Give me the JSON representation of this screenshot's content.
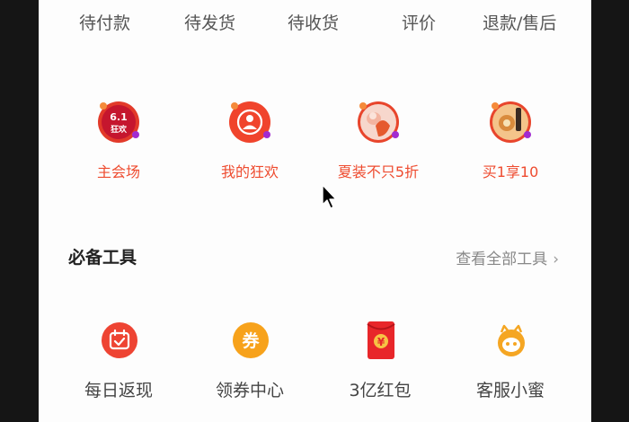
{
  "orders": {
    "tabs": [
      {
        "label": "待付款"
      },
      {
        "label": "待发货"
      },
      {
        "label": "待收货"
      },
      {
        "label": "评价"
      },
      {
        "label": "退款/售后"
      }
    ]
  },
  "promos": [
    {
      "label": "主会场",
      "icon": "festival-6-1-badge-icon",
      "badge_line1": "6.1",
      "badge_line2": "狂欢"
    },
    {
      "label": "我的狂欢",
      "icon": "user-profile-icon"
    },
    {
      "label": "夏装不只5折",
      "icon": "summer-clothes-thumbnail-icon"
    },
    {
      "label": "买1享10",
      "icon": "product-promo-thumbnail-icon"
    }
  ],
  "tools_section": {
    "title": "必备工具",
    "link": "查看全部工具"
  },
  "tools": [
    {
      "label": "每日返现",
      "icon": "calendar-icon"
    },
    {
      "label": "领券中心",
      "icon": "coupon-icon",
      "glyph": "券"
    },
    {
      "label": "3亿红包",
      "icon": "red-envelope-icon",
      "glyph": "¥"
    },
    {
      "label": "客服小蜜",
      "icon": "assistant-bot-icon"
    }
  ],
  "colors": {
    "accent_red": "#ee4b2f",
    "coupon_orange": "#f7a21b",
    "envelope_red": "#e8262a",
    "bot_orange": "#f5a623"
  }
}
